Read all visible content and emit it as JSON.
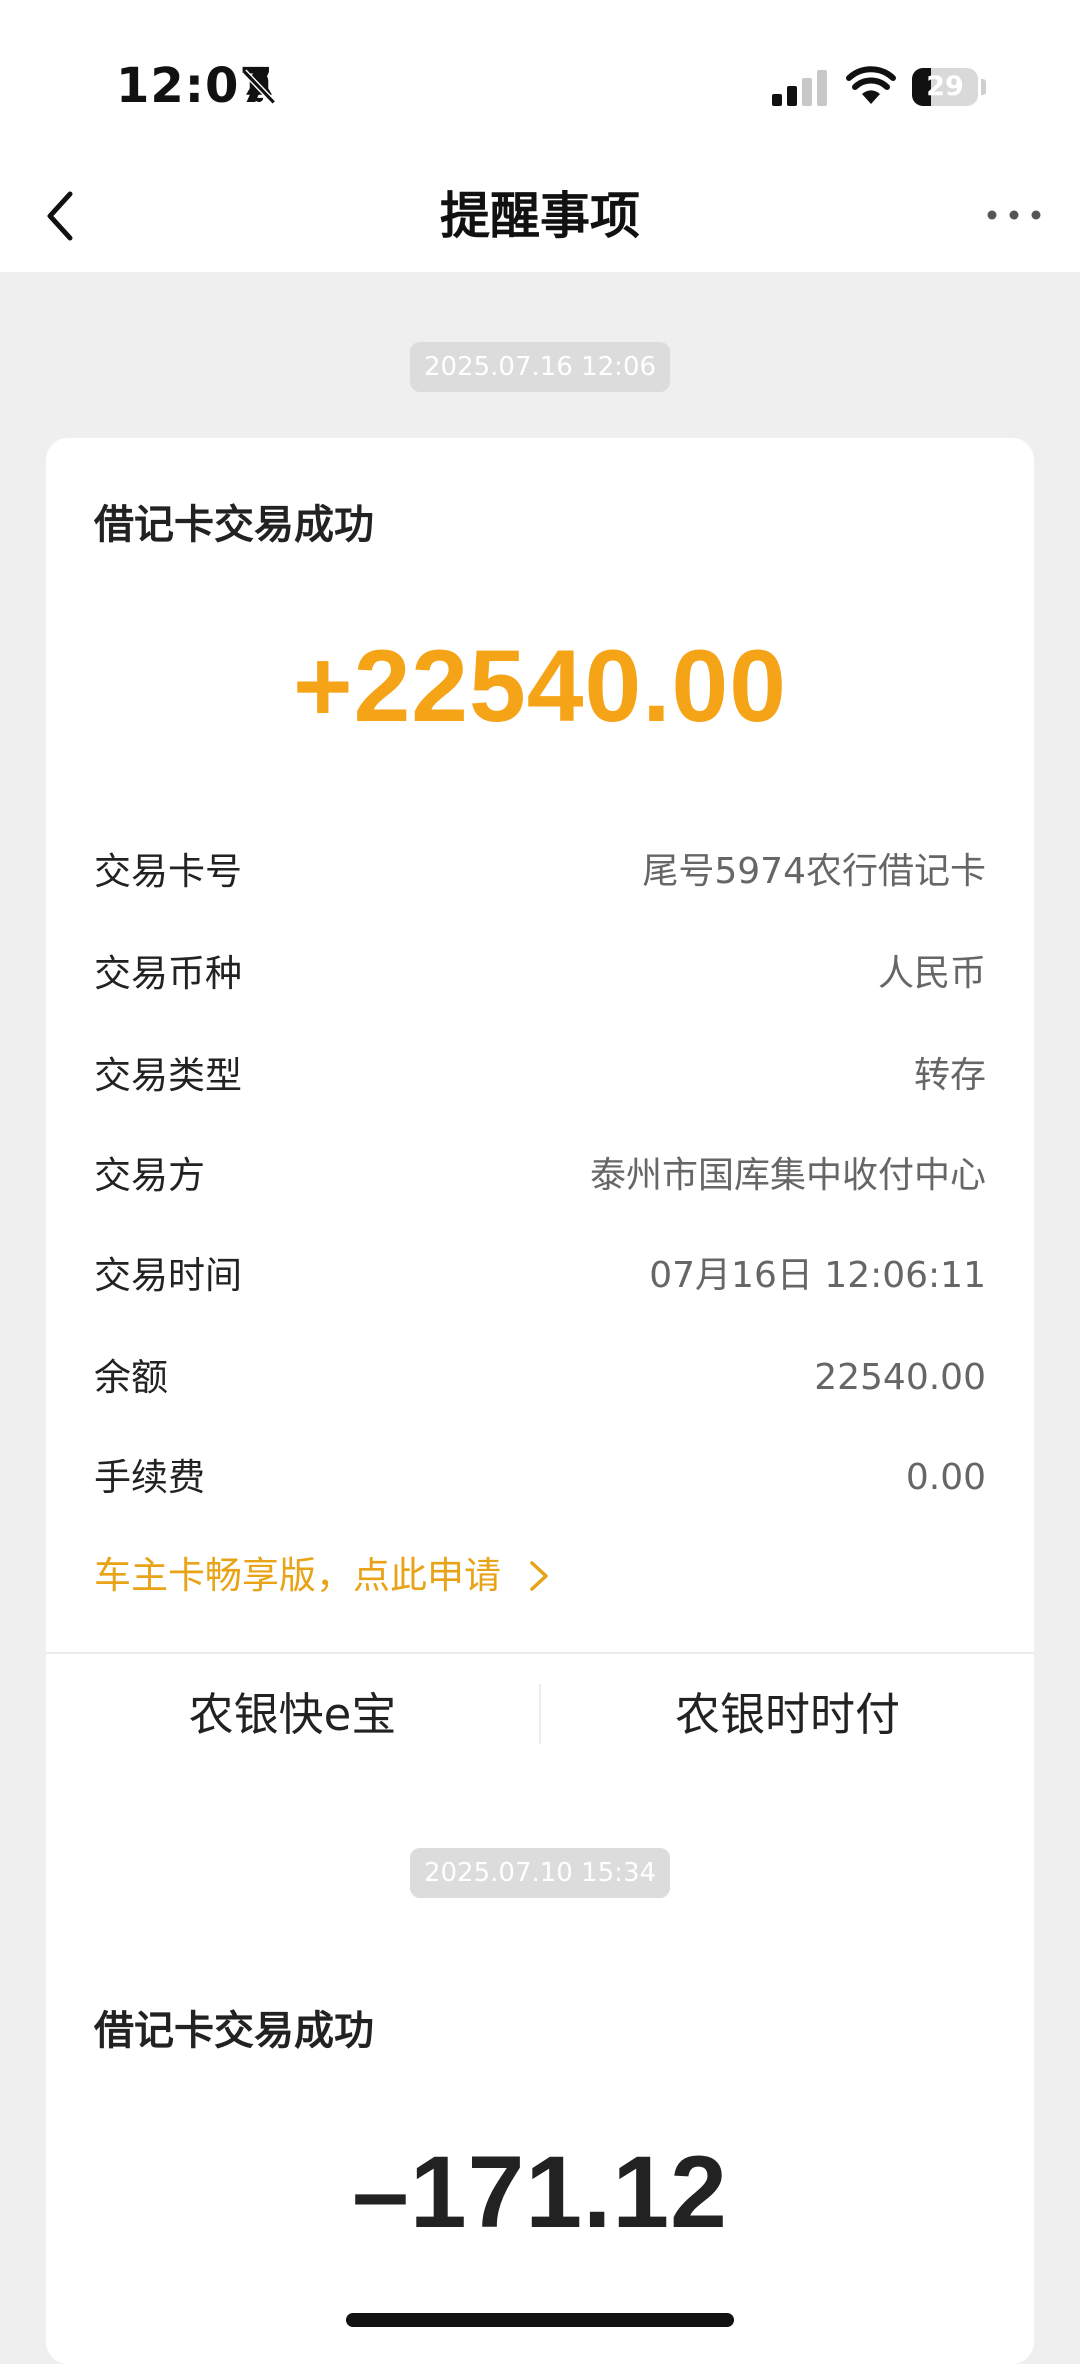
{
  "status_bar": {
    "time": "12:07",
    "battery_level": "29",
    "battery_fraction": 0.29,
    "icons": [
      "bell-slash-icon",
      "signal-icon",
      "wifi-icon",
      "battery-icon"
    ]
  },
  "nav": {
    "title": "提醒事项",
    "back_icon": "chevron-left-icon",
    "more_icon": "more-dots-icon"
  },
  "messages": [
    {
      "timestamp": "2025.07.16 12:06",
      "title": "借记卡交易成功",
      "amount": "+22540.00",
      "amount_color": "#f5a317",
      "details": [
        {
          "label": "交易卡号",
          "value": "尾号5974农行借记卡"
        },
        {
          "label": "交易币种",
          "value": "人民币"
        },
        {
          "label": "交易类型",
          "value": "转存"
        },
        {
          "label": "交易方",
          "value": "泰州市国库集中收付中心"
        },
        {
          "label": "交易时间",
          "value": "07月16日 12:06:11"
        },
        {
          "label": "余额",
          "value": "22540.00"
        },
        {
          "label": "手续费",
          "value": "0.00"
        }
      ],
      "promo_link": "车主卡畅享版，点此申请",
      "actions": [
        "农银快e宝",
        "农银时时付"
      ]
    },
    {
      "timestamp": "2025.07.10 15:34",
      "title": "借记卡交易成功",
      "amount": "–171.12",
      "amount_color": "#222222"
    }
  ],
  "colors": {
    "accent": "#e8a317",
    "background": "#efefef",
    "card": "#ffffff"
  }
}
